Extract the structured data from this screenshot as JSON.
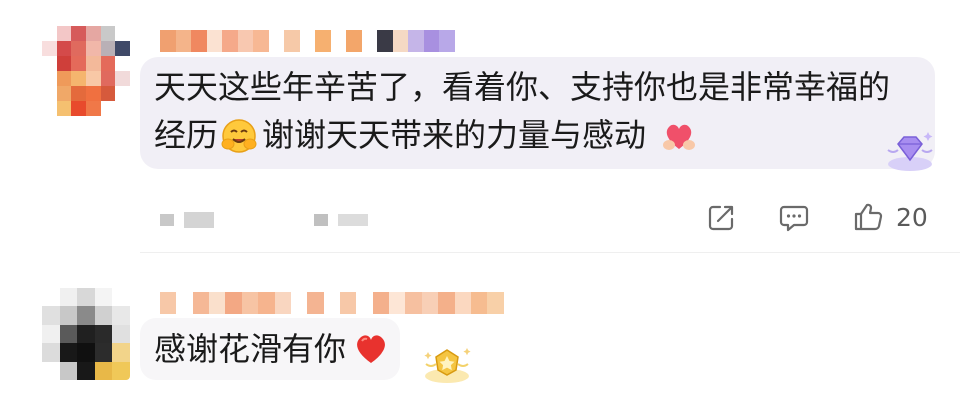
{
  "comments": [
    {
      "text_line1": "天天这些年辛苦了，看着你、支持你也是非常幸福的",
      "text_line2_a": "经历",
      "text_line2_b": "谢谢天天带来的力量与感动",
      "emoji_inline": "hugging-face-emoji",
      "emoji_end": "heart-hands-emoji",
      "badge": "diamond-badge-icon",
      "actions": {
        "share_icon": "share-icon",
        "reply_icon": "comment-icon",
        "like_icon": "thumbs-up-icon",
        "like_count": "20"
      }
    },
    {
      "text": "感谢花滑有你",
      "emoji_end": "red-heart-emoji",
      "badge": "gold-badge-icon"
    }
  ],
  "colors": {
    "bubble": "#f1eff6",
    "icon": "#6a6a6a",
    "text": "#1a1a1a"
  }
}
